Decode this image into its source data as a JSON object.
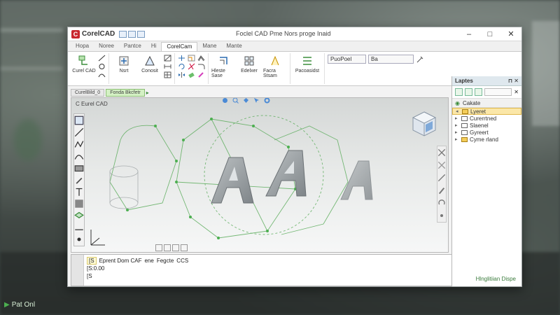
{
  "window": {
    "app_name": "CorelCAD",
    "title": "Foclel CAD Pme Nors proge Inaid",
    "controls": [
      "–",
      "□",
      "✕"
    ]
  },
  "ribbon_tabs": [
    {
      "label": "Hopa",
      "active": false
    },
    {
      "label": "Noree",
      "active": false
    },
    {
      "label": "Pantce",
      "active": false
    },
    {
      "label": "Hi",
      "active": false
    },
    {
      "label": "CorelCam",
      "active": true
    },
    {
      "label": "Mane",
      "active": false
    },
    {
      "label": "Mante",
      "active": false
    }
  ],
  "ribbon": {
    "buttons": [
      {
        "label": "Curel CAD"
      },
      {
        "label": "Nsrt"
      },
      {
        "label": "Conosit"
      },
      {
        "label": "Hleste Sase"
      },
      {
        "label": "Edelxer"
      },
      {
        "label": "Facra Stsam"
      },
      {
        "label": "Pacoasidst"
      }
    ],
    "combo_layer": "PuoPoel",
    "combo_color": "Ba"
  },
  "doc_tabs": [
    {
      "label": "CurelBild_0",
      "active": false
    },
    {
      "label": "Fonda Bkcfetr",
      "active": true
    }
  ],
  "viewport": {
    "label": "C Eurel CAD"
  },
  "layers_panel": {
    "title": "Laptes",
    "subheader": "Cakate",
    "items": [
      {
        "label": "Lyeret",
        "selected": true,
        "filled": true
      },
      {
        "label": "Curerrtned",
        "selected": false,
        "filled": false
      },
      {
        "label": "Slaenel",
        "selected": false,
        "filled": false
      },
      {
        "label": "Gyreert",
        "selected": false,
        "filled": false
      },
      {
        "label": "Cyme rland",
        "selected": false,
        "filled": true
      }
    ],
    "footer": "Hlnglitiian Dispe"
  },
  "command": {
    "line1_prefix": "[S",
    "line1_text": "Eprent Dom CAF",
    "line1_word2": "ene",
    "line1_word3": "Fegcte",
    "line1_word4": "CCS",
    "line2": "[S:0.00",
    "line3": "[S"
  },
  "taskbar": {
    "label": "Pat Onl"
  },
  "colors": {
    "accent_green": "#4caf50",
    "selected_layer": "#fbe7a8",
    "brand_red": "#c8262d"
  }
}
